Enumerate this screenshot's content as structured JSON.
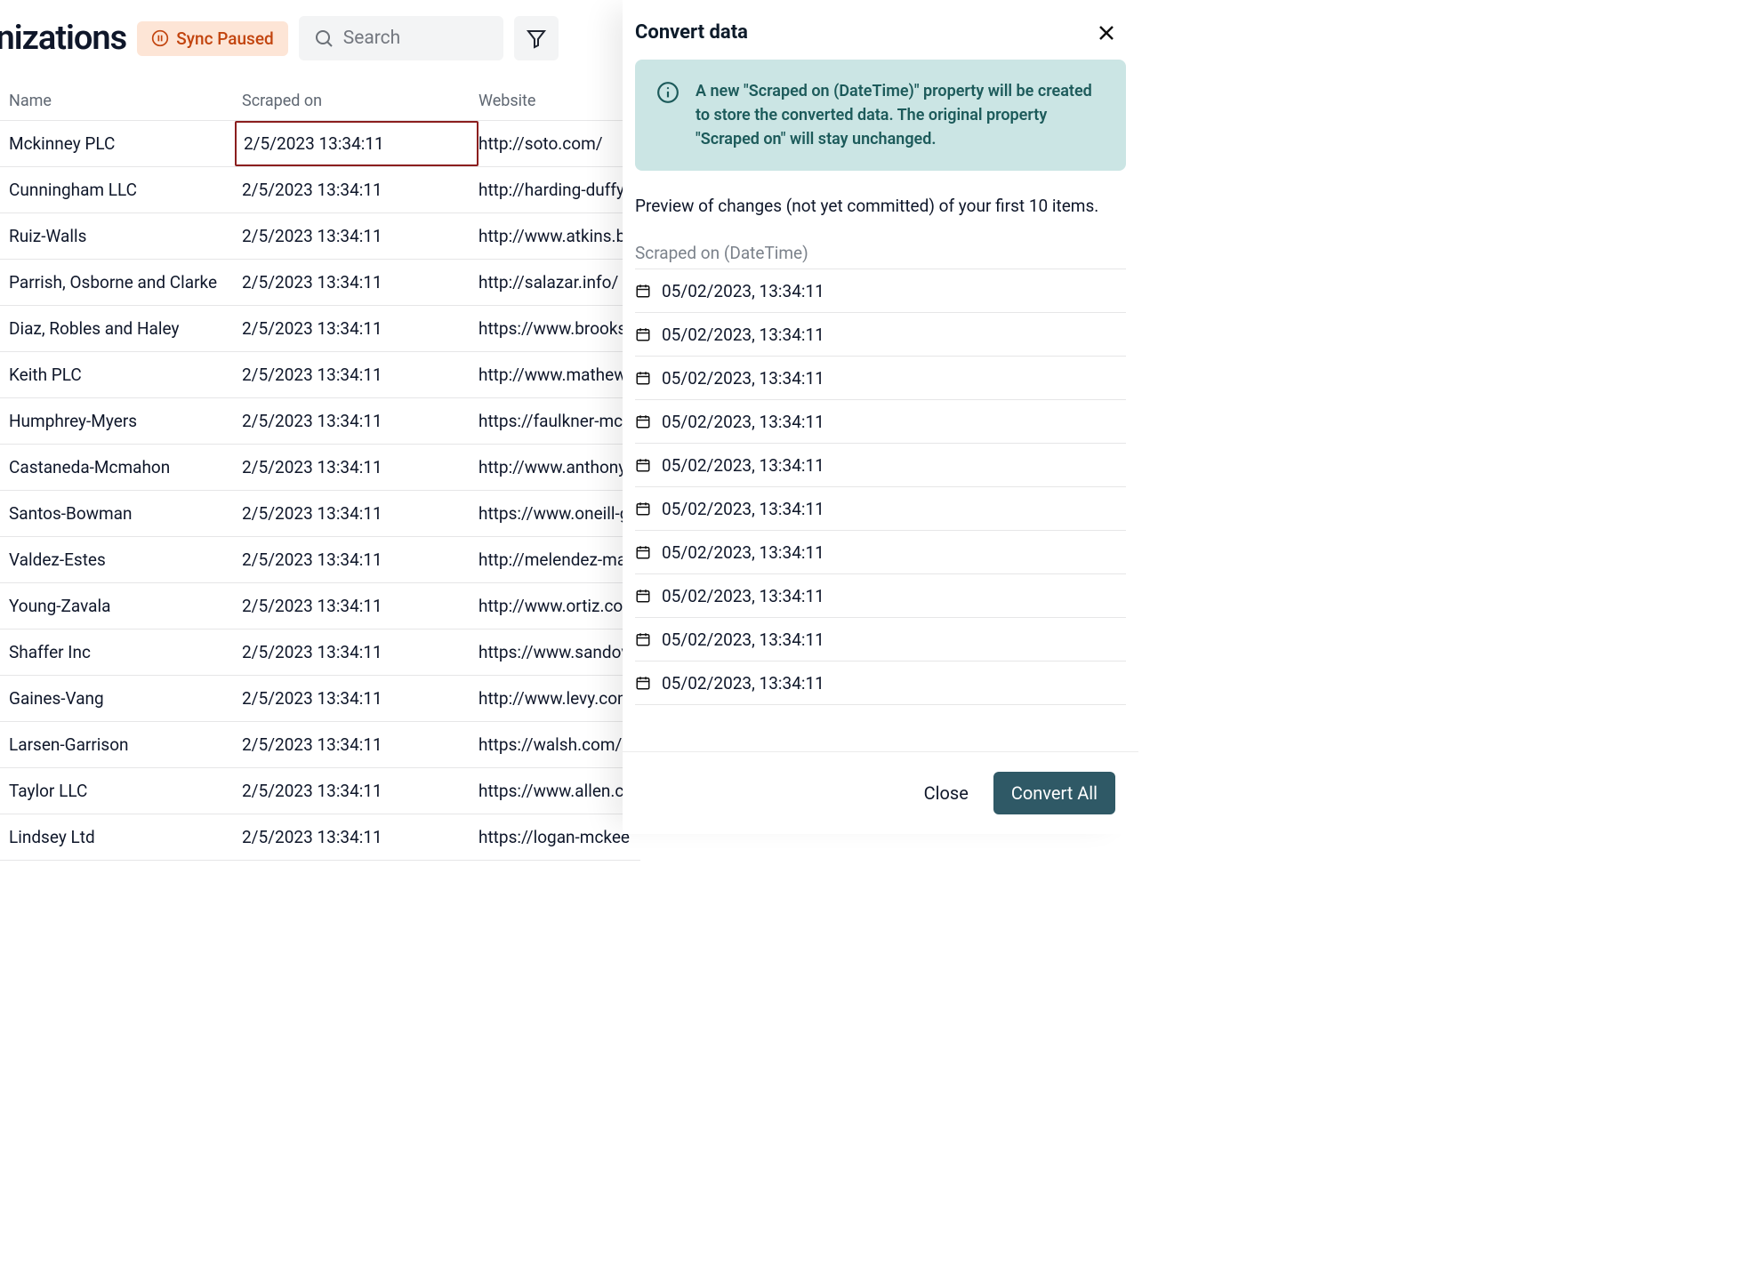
{
  "header": {
    "title": "Organizations",
    "sync_status": "Sync Paused",
    "search_placeholder": "Search"
  },
  "table": {
    "columns": [
      "Name",
      "Scraped on",
      "Website"
    ],
    "rows": [
      {
        "name": "Mckinney PLC",
        "scraped_on": "2/5/2023 13:34:11",
        "website": "http://soto.com/",
        "selected": true
      },
      {
        "name": "Cunningham LLC",
        "scraped_on": "2/5/2023 13:34:11",
        "website": "http://harding-duffy.c"
      },
      {
        "name": "Ruiz-Walls",
        "scraped_on": "2/5/2023 13:34:11",
        "website": "http://www.atkins.bi"
      },
      {
        "name": "Parrish, Osborne and Clarke",
        "scraped_on": "2/5/2023 13:34:11",
        "website": "http://salazar.info/"
      },
      {
        "name": "Diaz, Robles and Haley",
        "scraped_on": "2/5/2023 13:34:11",
        "website": "https://www.brooks-"
      },
      {
        "name": "Keith PLC",
        "scraped_on": "2/5/2023 13:34:11",
        "website": "http://www.mathews"
      },
      {
        "name": "Humphrey-Myers",
        "scraped_on": "2/5/2023 13:34:11",
        "website": "https://faulkner-mcla"
      },
      {
        "name": "Castaneda-Mcmahon",
        "scraped_on": "2/5/2023 13:34:11",
        "website": "http://www.anthony."
      },
      {
        "name": "Santos-Bowman",
        "scraped_on": "2/5/2023 13:34:11",
        "website": "https://www.oneill-g"
      },
      {
        "name": "Valdez-Estes",
        "scraped_on": "2/5/2023 13:34:11",
        "website": "http://melendez-mal"
      },
      {
        "name": "Young-Zavala",
        "scraped_on": "2/5/2023 13:34:11",
        "website": "http://www.ortiz.con"
      },
      {
        "name": "Shaffer Inc",
        "scraped_on": "2/5/2023 13:34:11",
        "website": "https://www.sandova"
      },
      {
        "name": "Gaines-Vang",
        "scraped_on": "2/5/2023 13:34:11",
        "website": "http://www.levy.com"
      },
      {
        "name": "Larsen-Garrison",
        "scraped_on": "2/5/2023 13:34:11",
        "website": "https://walsh.com/"
      },
      {
        "name": "Taylor LLC",
        "scraped_on": "2/5/2023 13:34:11",
        "website": "https://www.allen.co"
      },
      {
        "name": "Lindsey Ltd",
        "scraped_on": "2/5/2023 13:34:11",
        "website": "https://logan-mckee"
      }
    ]
  },
  "panel": {
    "title": "Convert data",
    "info_message": "A new \"Scraped on (DateTime)\" property will be created to store the converted data. The original property \"Scraped on\" will stay unchanged.",
    "preview_caption": "Preview of changes (not yet committed) of your first 10 items.",
    "preview_column": "Scraped on (DateTime)",
    "preview_items": [
      "05/02/2023, 13:34:11",
      "05/02/2023, 13:34:11",
      "05/02/2023, 13:34:11",
      "05/02/2023, 13:34:11",
      "05/02/2023, 13:34:11",
      "05/02/2023, 13:34:11",
      "05/02/2023, 13:34:11",
      "05/02/2023, 13:34:11",
      "05/02/2023, 13:34:11",
      "05/02/2023, 13:34:11"
    ],
    "close_label": "Close",
    "convert_label": "Convert All"
  }
}
